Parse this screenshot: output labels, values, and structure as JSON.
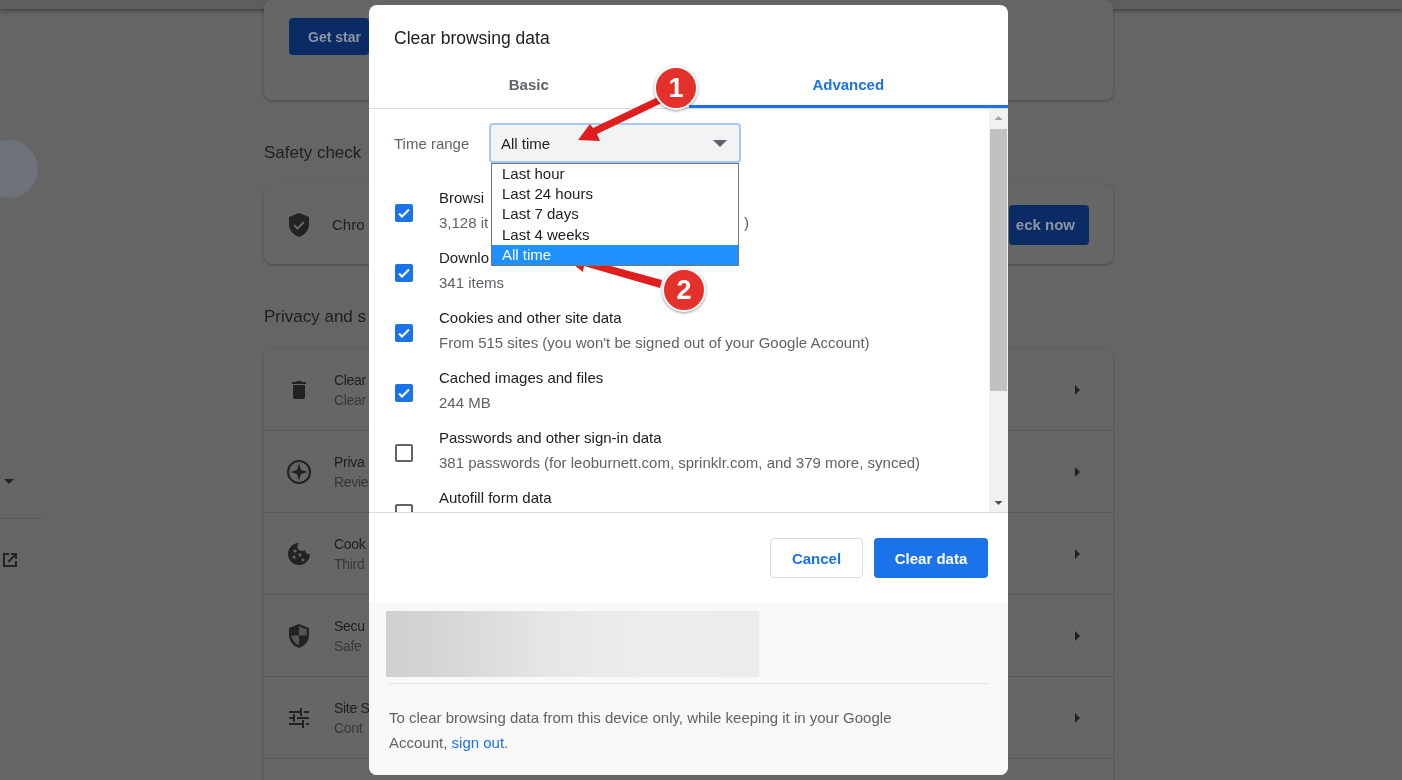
{
  "settings_page": {
    "get_started_button": "Get star",
    "safety_check": {
      "heading": "Safety check",
      "text": "Chro",
      "button": "eck now"
    },
    "privacy": {
      "heading": "Privacy and s",
      "rows": [
        {
          "kind": "trash",
          "title": "Clear",
          "subtitle": "Clear"
        },
        {
          "kind": "compass",
          "title": "Priva",
          "subtitle": "Revie"
        },
        {
          "kind": "cookie",
          "title": "Cook",
          "subtitle": "Third"
        },
        {
          "kind": "shield",
          "title": "Secu",
          "subtitle": "Safe"
        },
        {
          "kind": "sliders",
          "title": "Site S",
          "subtitle": "Cont"
        }
      ]
    }
  },
  "dialog": {
    "title": "Clear browsing data",
    "tabs": [
      {
        "label": "Basic",
        "selected": false
      },
      {
        "label": "Advanced",
        "selected": true
      }
    ],
    "time_range": {
      "label": "Time range",
      "value": "All time",
      "expanded": true,
      "options": [
        {
          "label": "Last hour",
          "selected": false
        },
        {
          "label": "Last 24 hours",
          "selected": false
        },
        {
          "label": "Last 7 days",
          "selected": false
        },
        {
          "label": "Last 4 weeks",
          "selected": false
        },
        {
          "label": "All time",
          "selected": true
        }
      ]
    },
    "items": [
      {
        "title": "Browsi",
        "description": "3,128 it",
        "description_end": ")",
        "checked": true
      },
      {
        "title": "Downlo",
        "description": "341 items",
        "checked": true
      },
      {
        "title": "Cookies and other site data",
        "description": "From 515 sites (you won't be signed out of your Google Account)",
        "checked": true
      },
      {
        "title": "Cached images and files",
        "description": "244 MB",
        "checked": true
      },
      {
        "title": "Passwords and other sign-in data",
        "description": "381 passwords (for leoburnett.com, sprinklr.com, and 379 more, synced)",
        "checked": false
      },
      {
        "title": "Autofill form data",
        "checked": false
      }
    ],
    "buttons": [
      {
        "label": "Cancel",
        "kind": "secondary"
      },
      {
        "label": "Clear data",
        "kind": "primary"
      }
    ],
    "footer": {
      "text": "To clear browsing data from this device only, while keeping it in your Google Account, ",
      "link": "sign out",
      "text_end": "."
    }
  },
  "annotations": [
    {
      "label": "1"
    },
    {
      "label": "2"
    }
  ]
}
